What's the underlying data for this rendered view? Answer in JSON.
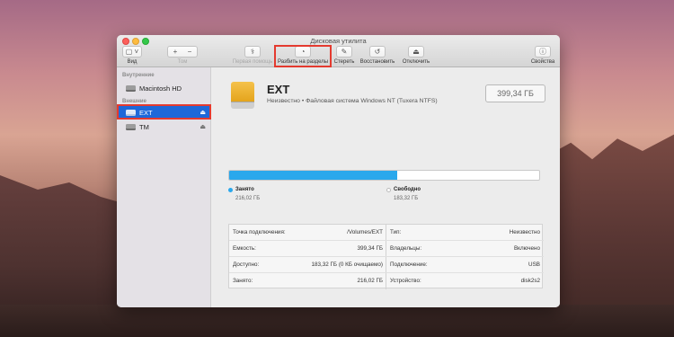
{
  "window": {
    "title": "Дисковая утилита"
  },
  "toolbar": {
    "view_label": "Вид",
    "volume_label": "Том",
    "rescue_label": "Первая помощь",
    "partition_label": "Разбить на разделы",
    "erase_label": "Стереть",
    "restore_label": "Восстановить",
    "unmount_label": "Отключить",
    "info_label": "Свойства"
  },
  "sidebar": {
    "internal_header": "Внутренние",
    "external_header": "Внешние",
    "items": [
      {
        "label": "Macintosh HD",
        "section": "internal",
        "selected": false
      },
      {
        "label": "EXT",
        "section": "external",
        "selected": true
      },
      {
        "label": "TM",
        "section": "external",
        "selected": false
      }
    ]
  },
  "volume": {
    "name": "EXT",
    "subtitle": "Неизвестно • Файловая система Windows NT (Tuxera NTFS)",
    "capacity": "399,34 ГБ"
  },
  "usage": {
    "used_fraction": 0.541,
    "used_label": "Занято",
    "used_value": "216,02 ГБ",
    "free_label": "Свободно",
    "free_value": "183,32 ГБ",
    "used_color": "#2aa8ec",
    "free_color": "#ffffff"
  },
  "info": {
    "left": [
      {
        "key": "Точка подключения:",
        "value": "/Volumes/EXT"
      },
      {
        "key": "Емкость:",
        "value": "399,34 ГБ"
      },
      {
        "key": "Доступно:",
        "value": "183,32 ГБ (0 КБ очищаемо)"
      },
      {
        "key": "Занято:",
        "value": "216,02 ГБ"
      }
    ],
    "right": [
      {
        "key": "Тип:",
        "value": "Неизвестно"
      },
      {
        "key": "Владельцы:",
        "value": "Включено"
      },
      {
        "key": "Подключение:",
        "value": "USB"
      },
      {
        "key": "Устройство:",
        "value": "disk2s2"
      }
    ]
  },
  "colors": {
    "highlight": "#e43a2f",
    "selection": "#1e68d9"
  }
}
